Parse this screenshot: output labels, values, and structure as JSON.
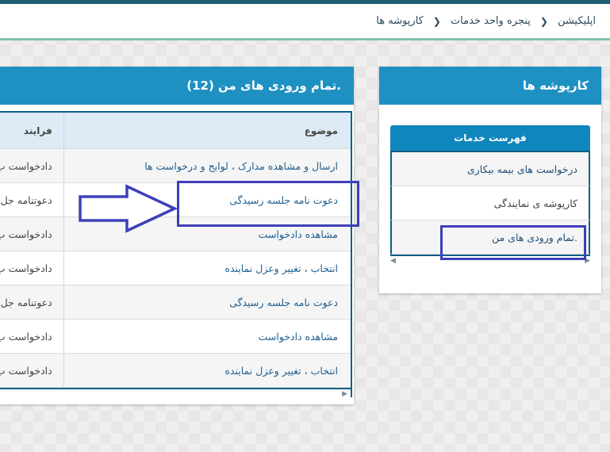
{
  "breadcrumb": [
    "اپلیکیشن",
    "پنجره واحد خدمات",
    "کارپوشه ها"
  ],
  "right_panel": {
    "title": "کارپوشه ها",
    "services_header": "فهرست خدمات",
    "items": [
      "درخواست های بیمه بیکاری",
      "کارپوشه ی نمایندگی",
      ".تمام ورودی های من"
    ]
  },
  "left_panel": {
    "title": ".تمام ورودی های من (12)",
    "columns": {
      "topic": "موضوع",
      "process": "فرایند"
    },
    "rows": [
      {
        "topic": "ارسال و مشاهده مدارک ، لوایح و درخواست ها",
        "process": "دادخواست ب"
      },
      {
        "topic": "دعوت نامه جلسه رسیدگی",
        "process": "دعوتنامه جل"
      },
      {
        "topic": "مشاهده دادخواست",
        "process": "دادخواست ب"
      },
      {
        "topic": "انتخاب ، تغییر وعزل نماینده",
        "process": "دادخواست ب"
      },
      {
        "topic": "دعوت نامه جلسه رسیدگی",
        "process": "دعوتنامه جل"
      },
      {
        "topic": "مشاهده دادخواست",
        "process": "دادخواست ب"
      },
      {
        "topic": "انتخاب ، تغییر وعزل نماینده",
        "process": "دادخواست ب"
      }
    ]
  },
  "colors": {
    "header_blue": "#1e90c2",
    "highlight": "#3d3fb8",
    "accent_green": "#7fc3a8"
  }
}
